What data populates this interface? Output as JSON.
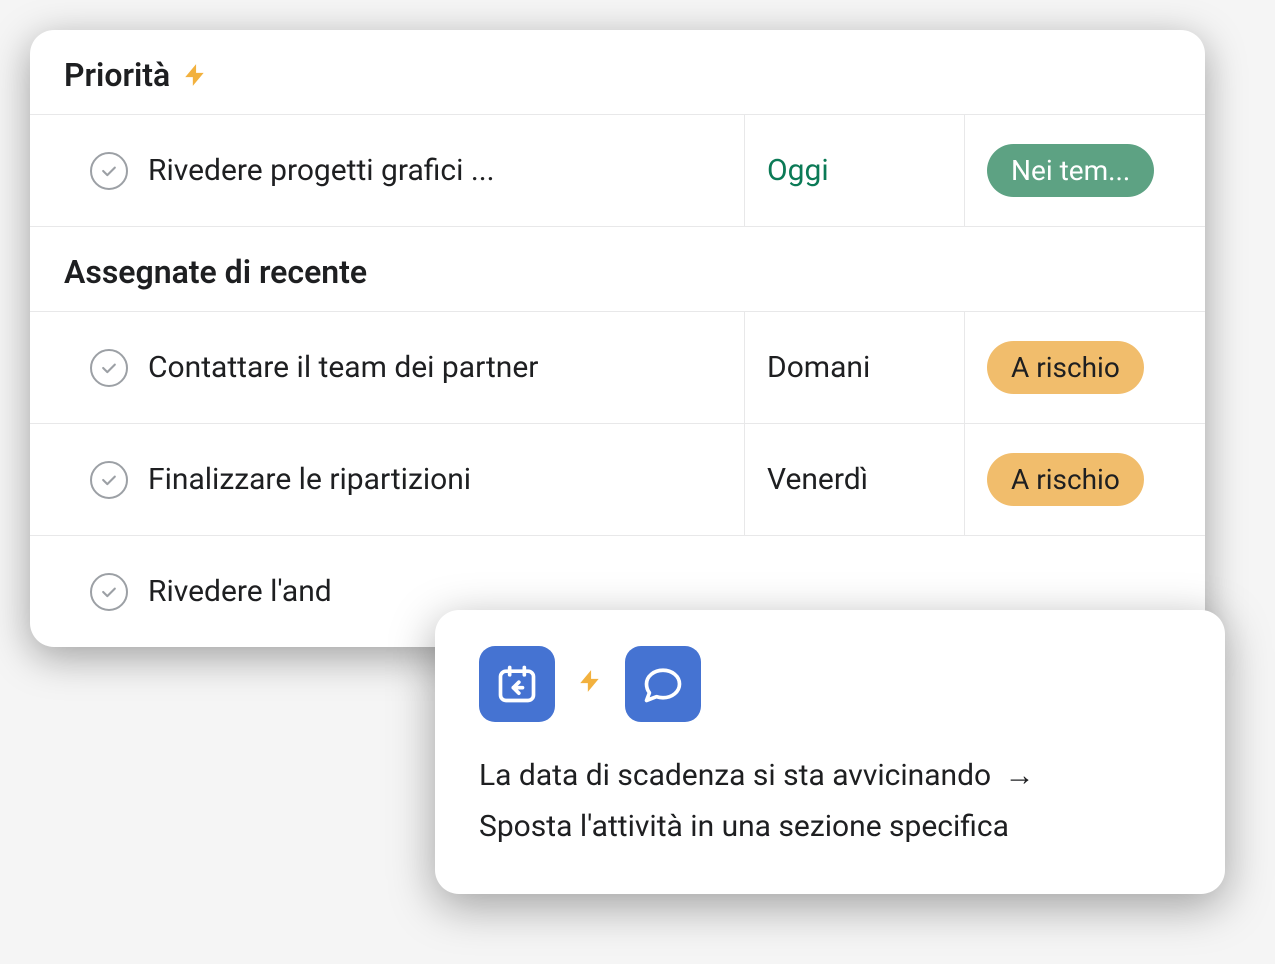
{
  "sections": {
    "priority": {
      "title": "Priorità",
      "tasks": [
        {
          "name": "Rivedere progetti grafici ...",
          "due": "Oggi",
          "due_class": "today",
          "status": "Nei tem...",
          "status_class": "green"
        }
      ]
    },
    "recent": {
      "title": "Assegnate di recente",
      "tasks": [
        {
          "name": "Contattare il team dei partner",
          "due": "Domani",
          "due_class": "",
          "status": "A rischio",
          "status_class": "orange"
        },
        {
          "name": "Finalizzare le ripartizioni",
          "due": "Venerdì",
          "due_class": "",
          "status": "A rischio",
          "status_class": "orange"
        },
        {
          "name": "Rivedere l'and",
          "due": "",
          "due_class": "",
          "status": "",
          "status_class": ""
        }
      ]
    }
  },
  "popover": {
    "line1": "La data di scadenza si sta avvicinando",
    "arrow": "→",
    "line2": "Sposta l'attività in una sezione specifica"
  },
  "icons": {
    "bolt": "⚡",
    "check": "✓"
  }
}
